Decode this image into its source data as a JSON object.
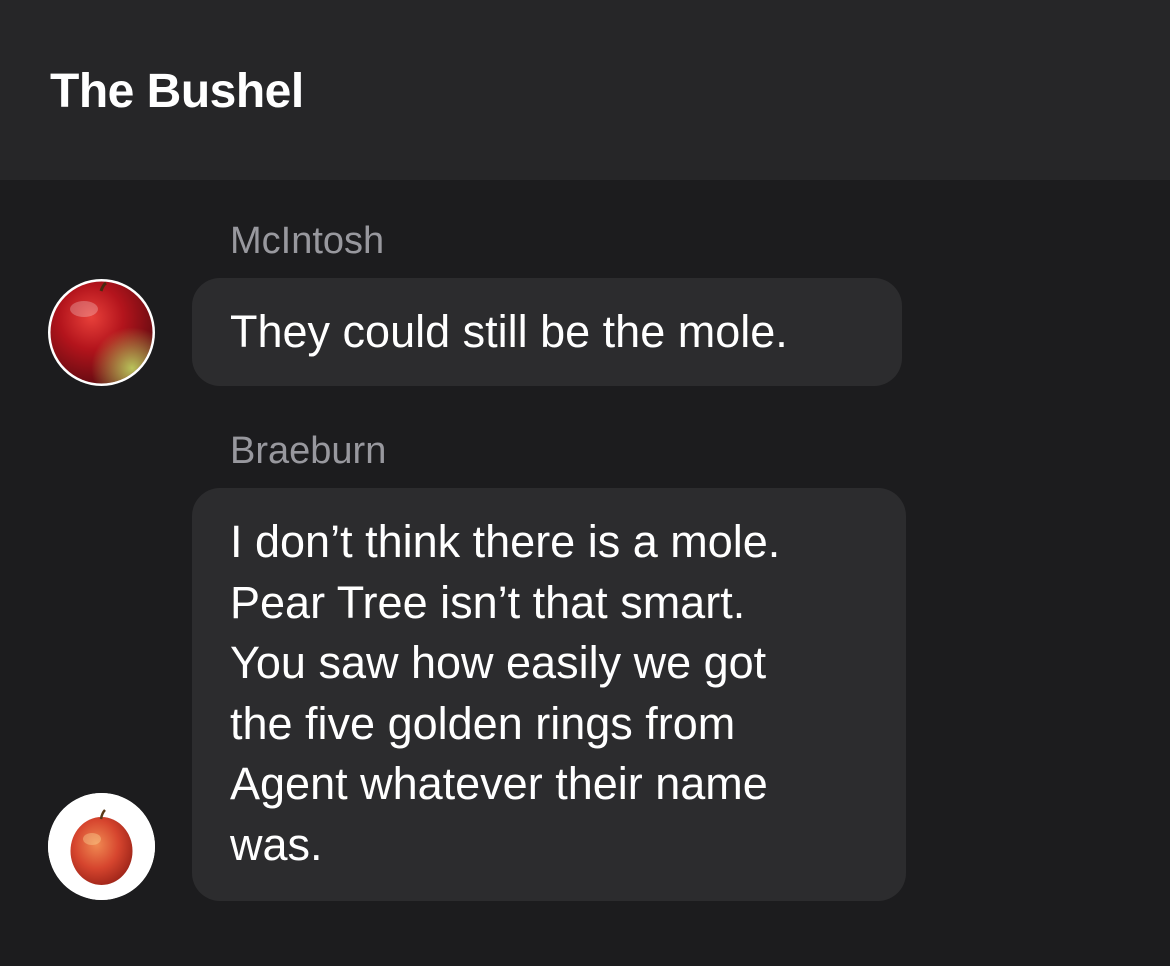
{
  "header": {
    "title": "The Bushel"
  },
  "messages": [
    {
      "sender": "McIntosh",
      "avatar_icon": "red-apple-icon",
      "text": "They could still be the mole."
    },
    {
      "sender": "Braeburn",
      "avatar_icon": "red-yellow-apple-icon",
      "lines": [
        "I don’t think there is a mole.",
        "Pear Tree isn’t that smart.",
        "You saw how easily we got",
        "the five golden rings from",
        "Agent whatever their name",
        "was."
      ]
    }
  ],
  "colors": {
    "background": "#1c1c1e",
    "header": "#262628",
    "bubble": "#2c2c2e",
    "sender_label": "#98989e",
    "text": "#ffffff"
  }
}
